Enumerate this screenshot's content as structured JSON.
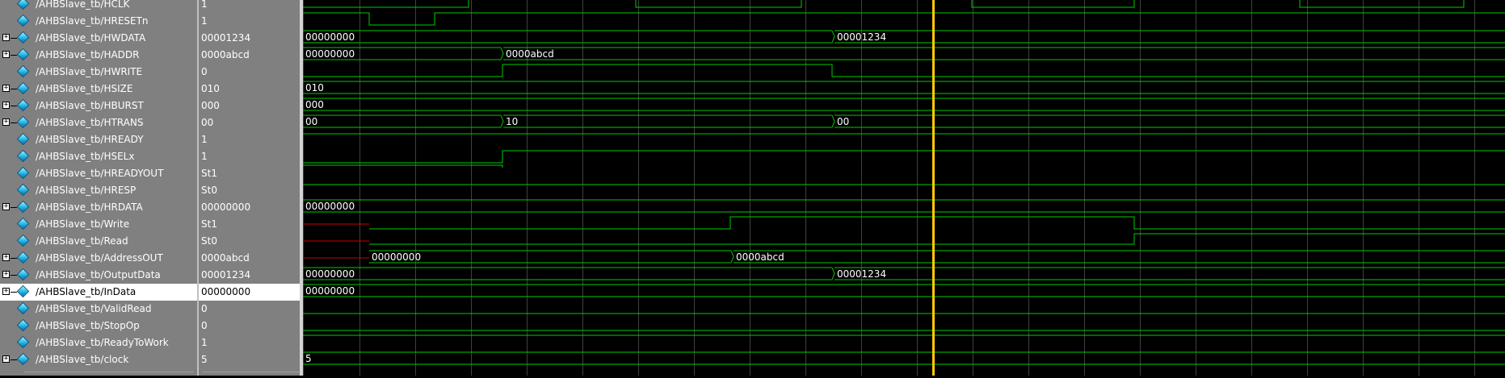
{
  "signals": [
    {
      "name": "/AHBSlave_tb/HCLK",
      "value": "1",
      "bus": false
    },
    {
      "name": "/AHBSlave_tb/HRESETn",
      "value": "1",
      "bus": false
    },
    {
      "name": "/AHBSlave_tb/HWDATA",
      "value": "00001234",
      "bus": true
    },
    {
      "name": "/AHBSlave_tb/HADDR",
      "value": "0000abcd",
      "bus": true
    },
    {
      "name": "/AHBSlave_tb/HWRITE",
      "value": "0",
      "bus": false
    },
    {
      "name": "/AHBSlave_tb/HSIZE",
      "value": "010",
      "bus": true
    },
    {
      "name": "/AHBSlave_tb/HBURST",
      "value": "000",
      "bus": true
    },
    {
      "name": "/AHBSlave_tb/HTRANS",
      "value": "00",
      "bus": true
    },
    {
      "name": "/AHBSlave_tb/HREADY",
      "value": "1",
      "bus": false
    },
    {
      "name": "/AHBSlave_tb/HSELx",
      "value": "1",
      "bus": false
    },
    {
      "name": "/AHBSlave_tb/HREADYOUT",
      "value": "St1",
      "bus": false
    },
    {
      "name": "/AHBSlave_tb/HRESP",
      "value": "St0",
      "bus": false
    },
    {
      "name": "/AHBSlave_tb/HRDATA",
      "value": "00000000",
      "bus": true
    },
    {
      "name": "/AHBSlave_tb/Write",
      "value": "St1",
      "bus": false
    },
    {
      "name": "/AHBSlave_tb/Read",
      "value": "St0",
      "bus": false
    },
    {
      "name": "/AHBSlave_tb/AddressOUT",
      "value": "0000abcd",
      "bus": true
    },
    {
      "name": "/AHBSlave_tb/OutputData",
      "value": "00001234",
      "bus": true
    },
    {
      "name": "/AHBSlave_tb/InData",
      "value": "00000000",
      "bus": true,
      "selected": true
    },
    {
      "name": "/AHBSlave_tb/ValidRead",
      "value": "0",
      "bus": false
    },
    {
      "name": "/AHBSlave_tb/StopOp",
      "value": "0",
      "bus": false
    },
    {
      "name": "/AHBSlave_tb/ReadyToWork",
      "value": "1",
      "bus": false
    },
    {
      "name": "/AHBSlave_tb/clock",
      "value": "5",
      "bus": true
    }
  ],
  "wave_labels": {
    "hwdata_a": "00000000",
    "hwdata_b": "00001234",
    "haddr_a": "00000000",
    "haddr_b": "0000abcd",
    "hsize": "010",
    "hburst": "000",
    "htrans_a": "00",
    "htrans_b": "10",
    "htrans_c": "00",
    "hrdata": "00000000",
    "addrout_a": "00000000",
    "addrout_b": "0000abcd",
    "outdata_a": "00000000",
    "outdata_b": "00001234",
    "indata": "00000000",
    "clock": "5"
  },
  "colors": {
    "wave": "#00cc00",
    "undefined": "#cc0000",
    "cursor": "#ffcc00",
    "grid": "#404040"
  }
}
